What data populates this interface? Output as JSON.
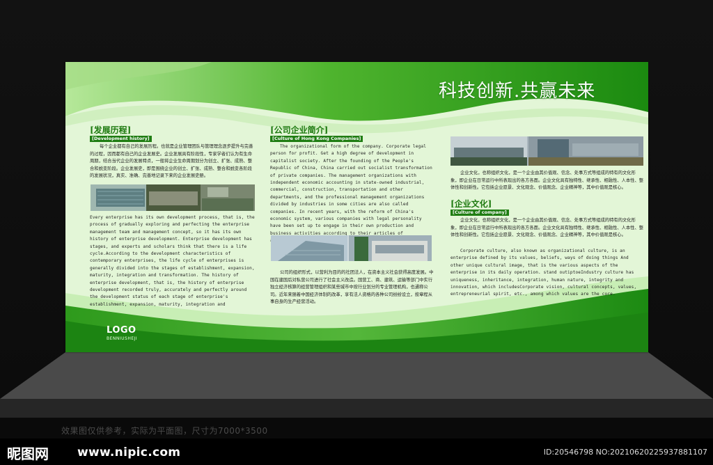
{
  "slogan": "科技创新.共赢未来",
  "logo": {
    "main": "LOGO",
    "sub": "BENNIUSHEJI"
  },
  "col1": {
    "heading_cn": "[发展历程]",
    "heading_en": "[Development history]",
    "para_cn": "每个企业都有自己的发展历程。也就是企业管理团队与管理理念逐步提升与完善的过程，因而都有自己的企业发展史。企业发展具有阶段性，专家学者们认为有生命周期，结合当代企业的发展特点，一般将企业生命周期划分为创立、扩张、成熟、整合和蜕变阶段。企业发展史，即是围绕企业的创立、扩张、成熟、整合和蜕变各阶段的发展状况，真实、准确、完善地记录下来的企业发展史册。",
    "para_en": "Every enterprise has its own development process, that is, the process of gradually exploring and perfecting the enterprise management team and management concept, so it has its own history of enterprise development. Enterprise development has stages, and experts and scholars think that there is a life cycle.According to the development characteristics of contemporary enterprises, the life cycle of enterprises is generally divided into the stages of establishment, expansion, maturity, integration and transformation. The history of enterprise development, that is, the history of enterprise development recorded truly, accurately and perfectly around the development status of each stage of enterprise's establishment, expansion, maturity, integration and transformation."
  },
  "col2": {
    "heading_cn": "[公司企业简介]",
    "heading_en": "[Culture of Hong Kong Companies]",
    "para_en": "The organizational form of the company. Corporate legal person for profit. Get a high degree of development in capitalist society. After the founding of the People's Republic of China, China carried out socialist transformation of private companies. The management organizations with independent economic accounting in state-owned industrial, commercial, construction, transportation and other departments, and the professional management organizations divided by industries in some cities are also called companies. In recent years, with the reform of China's economic system, various companies with legal personality have been set up to engage in their own production and business activities according to their articles of association.",
    "para_cn": "公司的组织形式，以营利为目的的社团法人，在资本主义社会获得高度发展。中国在建国后对私营公司进行了社会主义改造。国营工、商、建筑、运输等部门中实行独立经济核算的经营管理组织和某些城市中按行业划分的专业管理机构，也通称公司。近年来随着中国经济体制的改革，享有法人资格的各种公司纷纷设立，按章程从事自身的生产经营活动。"
  },
  "col3": {
    "para_cn_top": "企业文化，也称组织文化，是一个企业由其价值观、信念、处事方式等组成的特有的文化形象，即企业在日常运行中所表现出的各方各面。企业文化具有独特性、继承性、相融性、人本性、整体性和创新性。它包括企业愿景、文化观念、价值观念、企业精神等，其中价值观是核心。",
    "heading_cn": "[企业文化]",
    "heading_en": "[Culture of company]",
    "para_cn": "企业文化，也称组织文化，是一个企业由其价值观、信念、处事方式等组成的特有的文化形象，即企业在日常运行中所表现出的各方各面。企业文化具有独特性、继承性、相融性、人本性、整体性和创新性。它包括企业愿景、文化观念、价值观念、企业精神等，其中价值观是核心。",
    "para_en": "Corporate culture, also known as organizational culture, is an enterprise defined by its values, beliefs, ways of doing things And other unique cultural image, that is the various aspects of the enterprise in its daily operation. stand outiptoeIndustry culture has uniqueness, inheritance, integration, human nature, integrity and innovation, which includesCorporate vision, cultural concepts, values, entrepreneurial spirit, etc., among which values are the core."
  },
  "caption": "效果图仅供参考，实际为平面图，尺寸为7000*3500",
  "watermark": {
    "site_logo": "昵图网",
    "site_url": "www.nipic.com",
    "image_id": "ID:20546798 NO:20210620225937881107"
  },
  "colors": {
    "green_dark": "#1a7d0c",
    "green_mid": "#38a820",
    "board_light": "#e4f7da"
  }
}
